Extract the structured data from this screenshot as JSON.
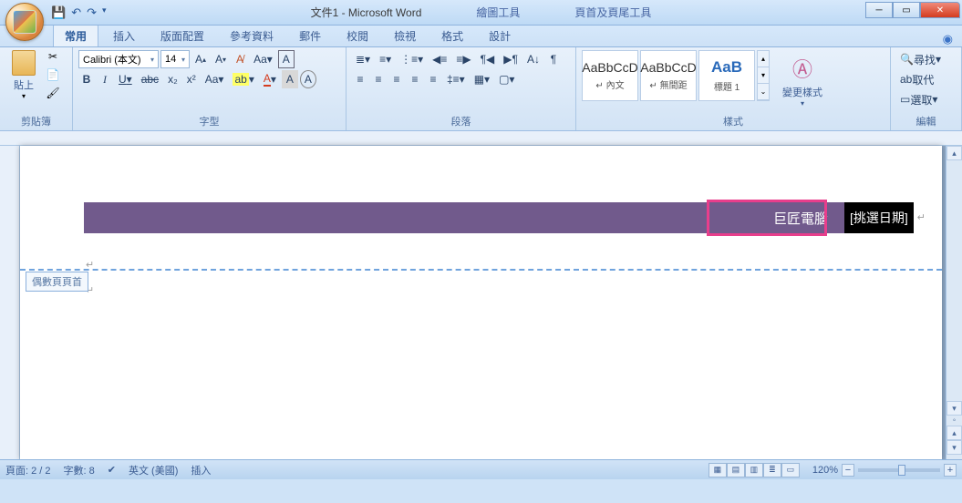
{
  "window": {
    "doc_title": "文件1 - Microsoft Word",
    "context_tools": [
      "繪圖工具",
      "頁首及頁尾工具"
    ]
  },
  "tabs": {
    "items": [
      "常用",
      "插入",
      "版面配置",
      "參考資料",
      "郵件",
      "校閱",
      "檢視",
      "格式",
      "設計"
    ],
    "active": "常用"
  },
  "ribbon": {
    "clipboard": {
      "label": "剪貼簿",
      "paste": "貼上"
    },
    "font": {
      "label": "字型",
      "name": "Calibri (本文)",
      "size": "14",
      "tips": {
        "bold": "B",
        "italic": "I",
        "underline": "U",
        "strike": "abc",
        "sub": "x₂",
        "sup": "x²",
        "case": "Aa",
        "highlight": "ab",
        "color": "A",
        "clear": "A",
        "box": "A",
        "grow": "A",
        "shrink": "A",
        "clear_fmt": "Aₐ"
      }
    },
    "para": {
      "label": "段落"
    },
    "styles": {
      "label": "樣式",
      "change": "變更樣式",
      "items": [
        {
          "preview": "AaBbCcD",
          "name": "↵ 內文"
        },
        {
          "preview": "AaBbCcD",
          "name": "↵ 無間距"
        },
        {
          "preview": "AaB",
          "name": "標題 1"
        }
      ]
    },
    "edit": {
      "label": "編輯",
      "find": "尋找",
      "replace": "取代",
      "select": "選取"
    }
  },
  "doc": {
    "purple_text": "巨匠電腦",
    "date_picker": "[挑選日期]",
    "header_tag": "偶數頁頁首"
  },
  "status": {
    "page": "頁面: 2 / 2",
    "words": "字數: 8",
    "lang": "英文 (美國)",
    "mode": "插入",
    "zoom": "120%"
  }
}
